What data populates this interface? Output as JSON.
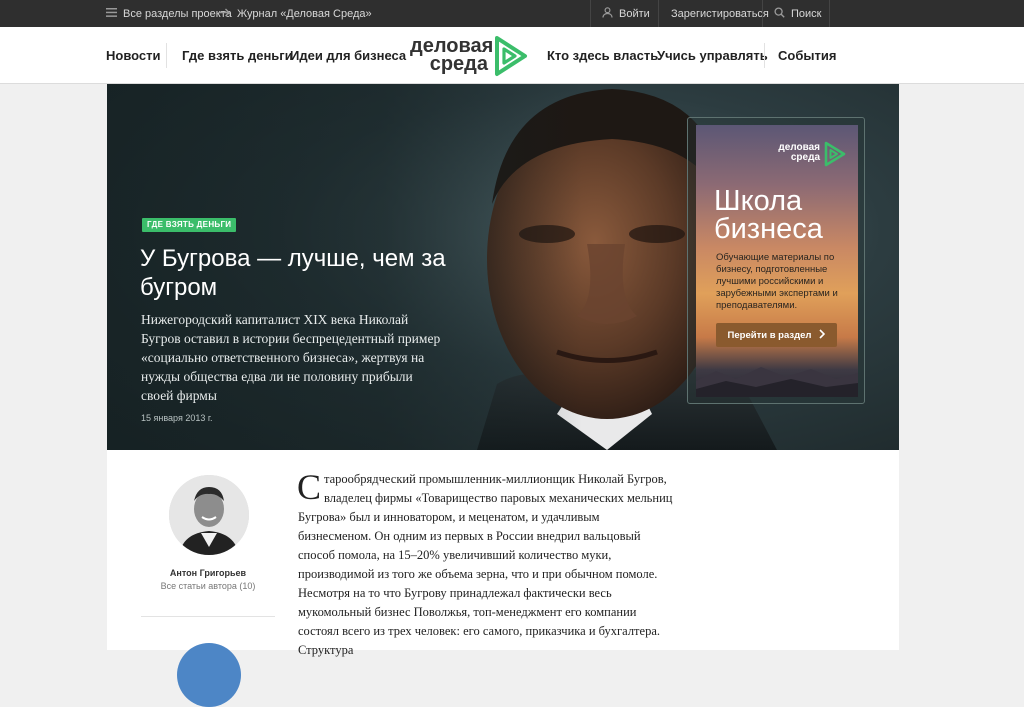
{
  "topbar": {
    "all_sections": "Все разделы проекта",
    "journal": "Журнал «Деловая Среда»",
    "login": "Войти",
    "register": "Зарегистироваться",
    "search": "Поиск"
  },
  "nav": {
    "items_left": [
      "Новости",
      "Где взять деньги",
      "Идеи для бизнеса"
    ],
    "items_right": [
      "Кто здесь власть",
      "Учись управлять",
      "События"
    ],
    "logo_line1": "деловая",
    "logo_line2": "среда",
    "brand_color": "#3bbd6a"
  },
  "hero": {
    "tag": "ГДЕ ВЗЯТЬ ДЕНЬГИ",
    "title": "У Бугрова — лучше, чем за бугром",
    "lead": "Нижегородский капиталист XIX века Николай Бугров оставил в истории беспрецедентный пример «социально ответственного бизнеса», жертвуя на нужды общества едва ли не половину прибыли своей фирмы",
    "date": "15 января 2013 г."
  },
  "ad": {
    "logo_line1": "деловая",
    "logo_line2": "среда",
    "title_line1": "Школа",
    "title_line2": "бизнеса",
    "text": "Обучающие материалы по бизнесу, подготовленные лучшими российскими и зарубежными экспертами и преподавателями.",
    "button": "Перейти в раздел"
  },
  "author": {
    "name": "Антон Григорьев",
    "all_articles": "Все статьи автора (10)"
  },
  "article": {
    "dropcap": "С",
    "text": "тарообрядческий промышленник-миллионщик Николай Бугров, владелец фирмы «Товарищество паровых механических мельниц Бугрова» был и инноватором, и меценатом, и удачливым бизнесменом. Он одним из первых в России внедрил вальцовый способ помола, на 15–20% увеличивший количество муки, производимой из того же объема зерна, что и при обычном помоле. Несмотря на то что Бугрову принадлежал фактически весь мукомольный бизнес Поволжья, топ-менеджмент его компании состоял всего из трех человек: его самого, приказчика и бухгалтера. Структура"
  }
}
